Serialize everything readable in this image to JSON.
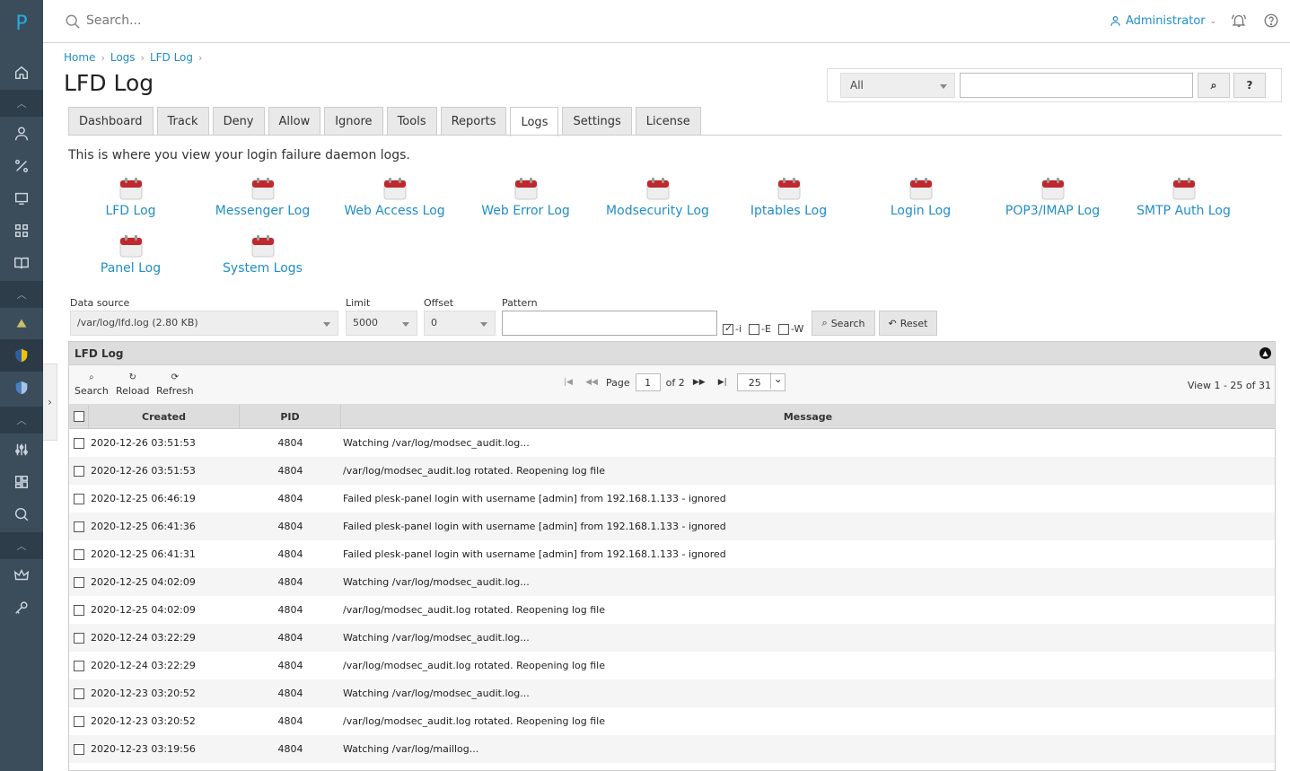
{
  "sidebar": {
    "logo": "P",
    "icons": [
      "home-icon",
      "chevron-up-icon",
      "user-icon",
      "percent-icon",
      "monitor-icon",
      "apps-icon",
      "book-icon",
      "chevron-up-icon",
      "extension-icon",
      "shield-icon",
      "shield2-icon",
      "chevron-up-icon",
      "sliders-icon",
      "dashboard-icon",
      "search-icon",
      "chevron-up-icon",
      "crown-icon",
      "key-icon"
    ]
  },
  "topbar": {
    "search_placeholder": "Search...",
    "user": "Administrator"
  },
  "breadcrumb": [
    "Home",
    "Logs",
    "LFD Log"
  ],
  "page_title": "LFD Log",
  "filter": {
    "scope": "All",
    "help": "?"
  },
  "tabs": [
    "Dashboard",
    "Track",
    "Deny",
    "Allow",
    "Ignore",
    "Tools",
    "Reports",
    "Logs",
    "Settings",
    "License"
  ],
  "active_tab": "Logs",
  "description": "This is where you view your login failure daemon logs.",
  "logs": [
    "LFD Log",
    "Messenger Log",
    "Web Access Log",
    "Web Error Log",
    "Modsecurity Log",
    "Iptables Log",
    "Login Log",
    "POP3/IMAP Log",
    "SMTP Auth Log",
    "Panel Log",
    "System Logs"
  ],
  "controls": {
    "data_source_label": "Data source",
    "data_source_value": "/var/log/lfd.log (2.80 KB)",
    "limit_label": "Limit",
    "limit_value": "5000",
    "offset_label": "Offset",
    "offset_value": "0",
    "pattern_label": "Pattern",
    "opt_i": "-i",
    "opt_e": "-E",
    "opt_w": "-W",
    "search_btn": "Search",
    "reset_btn": "Reset"
  },
  "grid": {
    "title": "LFD Log",
    "toolbar": [
      "Search",
      "Reload",
      "Refresh"
    ],
    "page_label": "Page",
    "page": "1",
    "of": "of 2",
    "rows_per_page": "25",
    "view_info": "View 1 - 25 of 31",
    "columns": [
      "Created",
      "PID",
      "Message"
    ],
    "rows": [
      [
        "2020-12-26 03:51:53",
        "4804",
        "Watching /var/log/modsec_audit.log..."
      ],
      [
        "2020-12-26 03:51:53",
        "4804",
        "/var/log/modsec_audit.log rotated. Reopening log file"
      ],
      [
        "2020-12-25 06:46:19",
        "4804",
        "Failed plesk-panel login with username [admin] from 192.168.1.133 - ignored"
      ],
      [
        "2020-12-25 06:41:36",
        "4804",
        "Failed plesk-panel login with username [admin] from 192.168.1.133 - ignored"
      ],
      [
        "2020-12-25 06:41:31",
        "4804",
        "Failed plesk-panel login with username [admin] from 192.168.1.133 - ignored"
      ],
      [
        "2020-12-25 04:02:09",
        "4804",
        "Watching /var/log/modsec_audit.log..."
      ],
      [
        "2020-12-25 04:02:09",
        "4804",
        "/var/log/modsec_audit.log rotated. Reopening log file"
      ],
      [
        "2020-12-24 03:22:29",
        "4804",
        "Watching /var/log/modsec_audit.log..."
      ],
      [
        "2020-12-24 03:22:29",
        "4804",
        "/var/log/modsec_audit.log rotated. Reopening log file"
      ],
      [
        "2020-12-23 03:20:52",
        "4804",
        "Watching /var/log/modsec_audit.log..."
      ],
      [
        "2020-12-23 03:20:52",
        "4804",
        "/var/log/modsec_audit.log rotated. Reopening log file"
      ],
      [
        "2020-12-23 03:19:56",
        "4804",
        "Watching /var/log/maillog..."
      ]
    ]
  }
}
